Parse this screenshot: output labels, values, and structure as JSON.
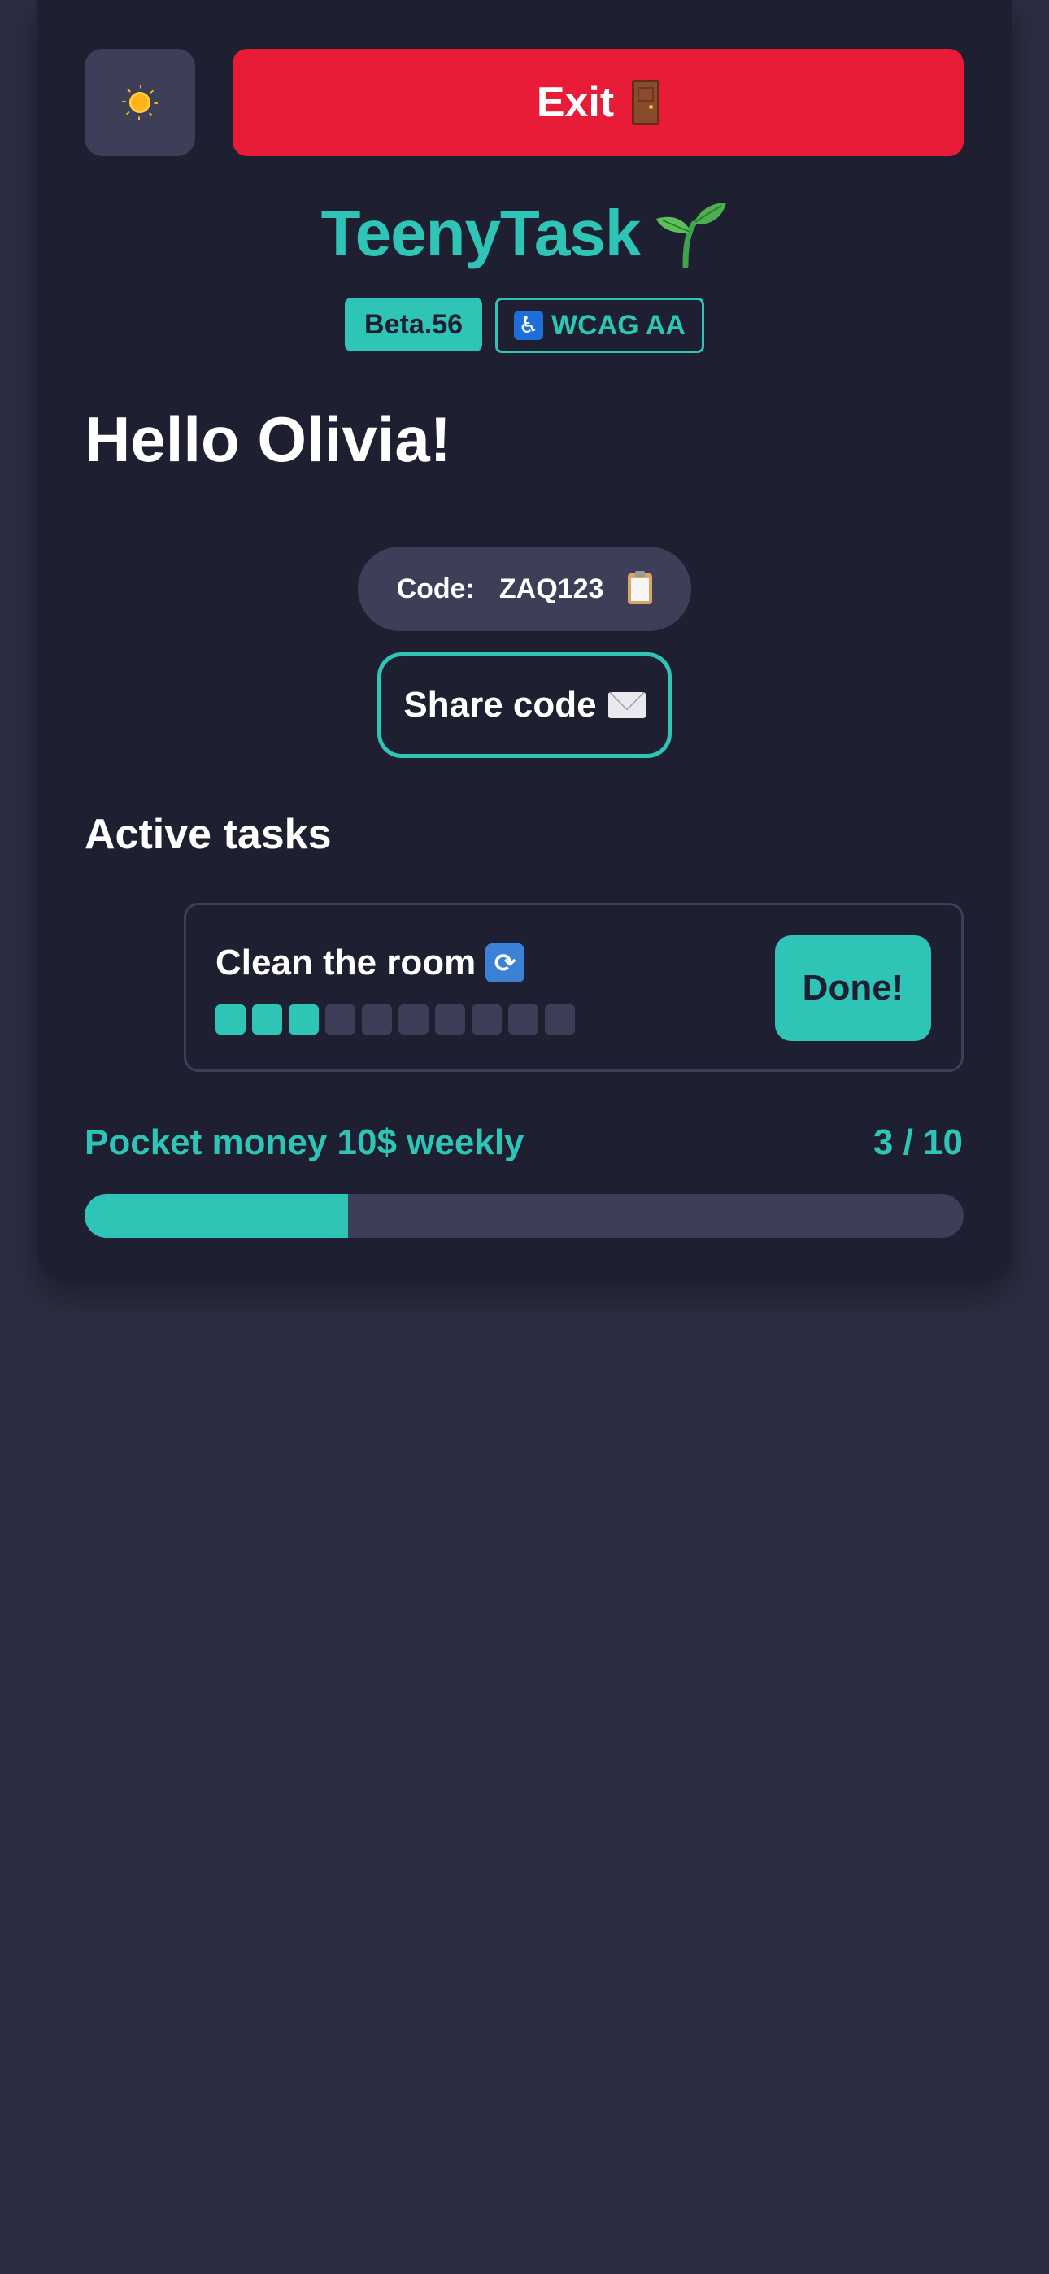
{
  "header": {
    "theme_toggle_icon": "sun-icon",
    "exit_label": "Exit",
    "exit_icon": "door-icon"
  },
  "brand": {
    "name": "TeenyTask",
    "logo_icon": "sprout-icon",
    "version_badge": "Beta.56",
    "accessibility_badge": "WCAG AA",
    "accessibility_icon": "wheelchair-icon"
  },
  "greeting": "Hello Olivia!",
  "code": {
    "label": "Code:",
    "value": "ZAQ123",
    "icon": "clipboard-icon"
  },
  "share": {
    "label": "Share code",
    "icon": "envelope-icon"
  },
  "tasks": {
    "section_title": "Active tasks",
    "items": [
      {
        "title": "Clean the room",
        "icon": "repeat-icon",
        "completed_steps": 3,
        "total_steps": 10,
        "done_label": "Done!"
      }
    ]
  },
  "reward": {
    "label": "Pocket money 10$ weekly",
    "count_text": "3 / 10",
    "progress_fraction": 0.3
  },
  "colors": {
    "accent": "#2ec4b6",
    "danger": "#e81c37",
    "card_bg": "#1e1f30",
    "page_bg": "#2b2d41",
    "muted": "#3d3e58"
  }
}
